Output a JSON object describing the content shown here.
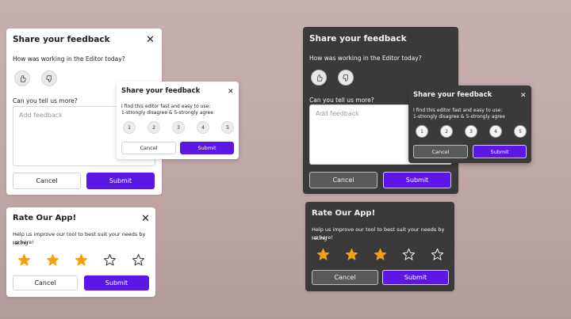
{
  "feedback": {
    "title": "Share your feedback",
    "question": "How was working in the Editor today?",
    "thumb_up_icon": "thumbs-up-icon",
    "thumb_down_icon": "thumbs-down-icon",
    "tell_more": "Can you tell us more?",
    "placeholder": "Add feedback",
    "cancel": "Cancel",
    "submit": "Submit"
  },
  "scale": {
    "title": "Share your feedback",
    "prompt_line1": "I find this editor fast and easy to use:",
    "prompt_line2": "1-strongly disagree & 5-strongly agree",
    "options": [
      "1",
      "2",
      "3",
      "4",
      "5"
    ],
    "cancel": "Cancel",
    "submit": "Submit"
  },
  "rate": {
    "title": "Rate Our App!",
    "description_line1": "Help us improve our tool to best suit your needs by rating",
    "description_line2": "us here!",
    "rating": 3,
    "max_rating": 5,
    "cancel": "Cancel",
    "submit": "Submit"
  },
  "colors": {
    "accent": "#5a17e6",
    "star_filled": "#f5a00f",
    "light_card": "#ffffff",
    "dark_card": "#3b3a3a"
  },
  "icons": {
    "close": "close-icon",
    "star": "star-icon"
  }
}
